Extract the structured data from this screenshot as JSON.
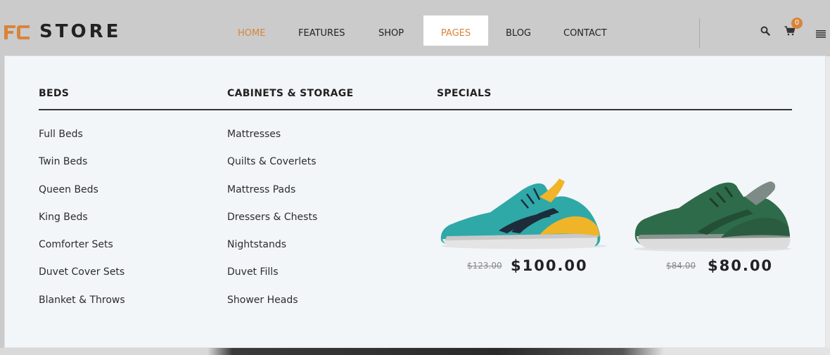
{
  "header": {
    "logo_text": "STORE",
    "logo_mark": "fc-logo-icon",
    "nav": [
      {
        "label": "HOME",
        "state": "active"
      },
      {
        "label": "FEATURES",
        "state": "normal"
      },
      {
        "label": "SHOP",
        "state": "normal"
      },
      {
        "label": "PAGES",
        "state": "open"
      },
      {
        "label": "BLOG",
        "state": "normal"
      },
      {
        "label": "CONTACT",
        "state": "normal"
      }
    ],
    "search_icon": "search-icon",
    "cart_icon": "cart-icon",
    "cart_count": "0",
    "menu_icon": "hamburger-menu-icon"
  },
  "dropdown": {
    "columns": [
      {
        "title": "BEDS",
        "items": [
          "Full Beds",
          "Twin Beds",
          "Queen Beds",
          "King Beds",
          "Comforter Sets",
          "Duvet Cover Sets",
          "Blanket & Throws"
        ]
      },
      {
        "title": "CABINETS & STORAGE",
        "items": [
          "Mattresses",
          "Quilts & Coverlets",
          "Mattress Pads",
          "Dressers & Chests",
          "Nightstands",
          "Duvet Fills",
          "Shower Heads"
        ]
      }
    ],
    "specials": {
      "title": "SPECIALS",
      "products": [
        {
          "image": "teal-sneaker-image",
          "old_price": "$123.00",
          "price": "$100.00"
        },
        {
          "image": "green-sneaker-image",
          "old_price": "$84.00",
          "price": "$80.00"
        }
      ]
    }
  },
  "colors": {
    "accent": "#d8843b",
    "header_bg": "#cbcbcb",
    "panel_bg": "#f3f6f9"
  }
}
